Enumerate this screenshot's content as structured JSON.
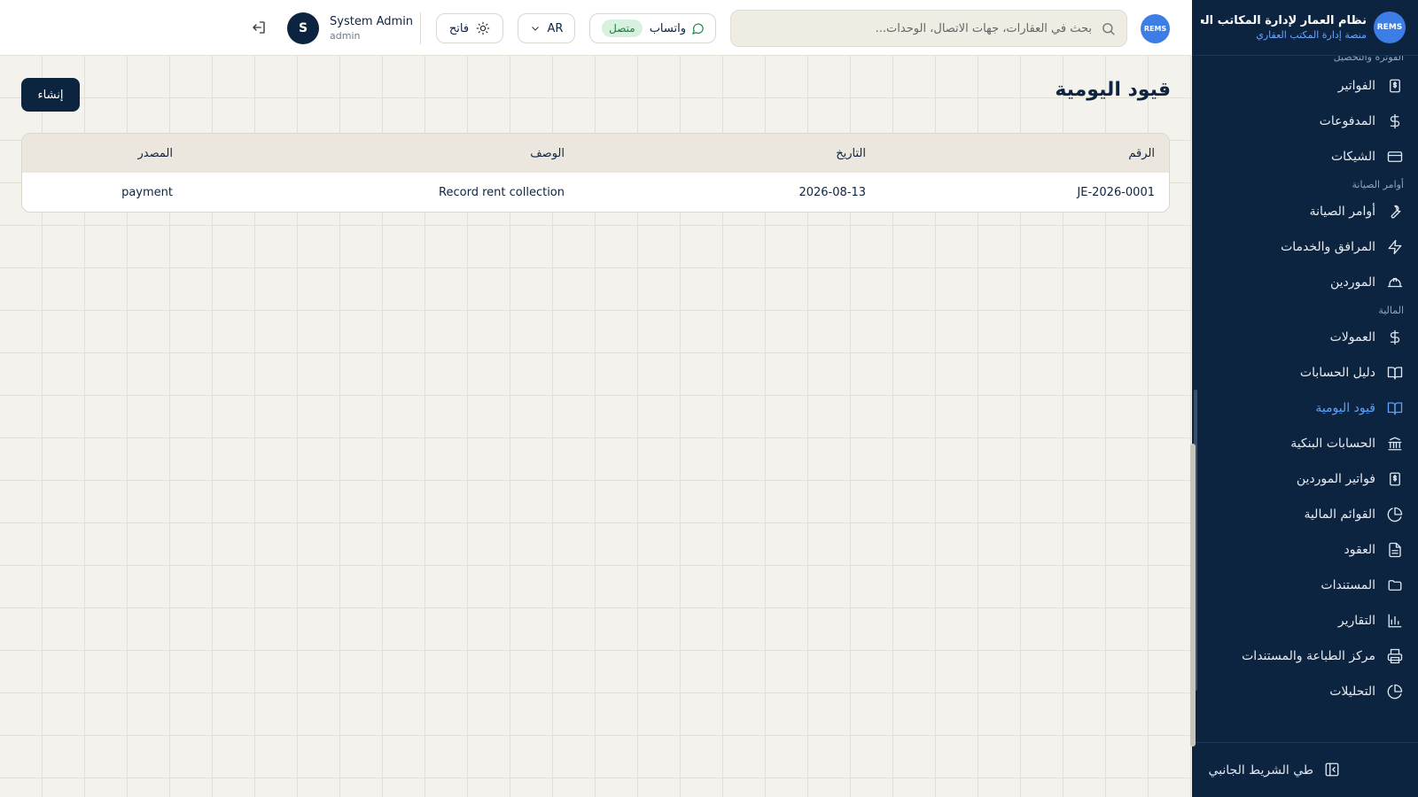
{
  "brand": {
    "logo_text": "REMS",
    "title": "نظام العمار لإدارة المكاتب العقارية",
    "subtitle": "منصة إدارة المكتب العقاري"
  },
  "sidebar": {
    "sections": [
      {
        "label": "الفوترة والتحصيل",
        "items": [
          {
            "label": "الفواتير",
            "icon": "invoice-icon"
          },
          {
            "label": "المدفوعات",
            "icon": "dollar-icon"
          },
          {
            "label": "الشيكات",
            "icon": "card-icon"
          }
        ]
      },
      {
        "label": "أوامر الصيانة",
        "items": [
          {
            "label": "أوامر الصيانة",
            "icon": "wrench-icon"
          },
          {
            "label": "المرافق والخدمات",
            "icon": "lightning-icon"
          },
          {
            "label": "الموردين",
            "icon": "hardhat-icon"
          }
        ]
      },
      {
        "label": "المالية",
        "items": [
          {
            "label": "العمولات",
            "icon": "dollar-icon"
          },
          {
            "label": "دليل الحسابات",
            "icon": "book-icon"
          },
          {
            "label": "قيود اليومية",
            "icon": "book-icon",
            "active": true
          },
          {
            "label": "الحسابات البنكية",
            "icon": "bank-icon"
          },
          {
            "label": "فواتير الموردين",
            "icon": "invoice-icon"
          },
          {
            "label": "القوائم المالية",
            "icon": "piechart-icon"
          },
          {
            "label": "العقود",
            "icon": "document-icon"
          },
          {
            "label": "المستندات",
            "icon": "folder-icon"
          },
          {
            "label": "التقارير",
            "icon": "barchart-icon"
          },
          {
            "label": "مركز الطباعة والمستندات",
            "icon": "printer-icon"
          },
          {
            "label": "التحليلات",
            "icon": "piechart-icon"
          }
        ]
      }
    ],
    "collapse_label": "طي الشريط الجانبي"
  },
  "topbar": {
    "logo_text": "REMS",
    "search_placeholder": "بحث في العقارات، جهات الاتصال، الوحدات...",
    "whatsapp_label": "واتساب",
    "whatsapp_status": "متصل",
    "language": "AR",
    "theme_label": "فاتح",
    "user_initial": "S",
    "user_name": "System Admin",
    "user_role": "admin"
  },
  "page": {
    "title": "قيود اليومية",
    "create_label": "إنشاء"
  },
  "table": {
    "columns": [
      "الرقم",
      "التاريخ",
      "الوصف",
      "المصدر"
    ],
    "rows": [
      {
        "number": "JE-2026-0001",
        "date": "2026-08-13",
        "description": "Record rent collection",
        "source": "payment"
      }
    ]
  }
}
